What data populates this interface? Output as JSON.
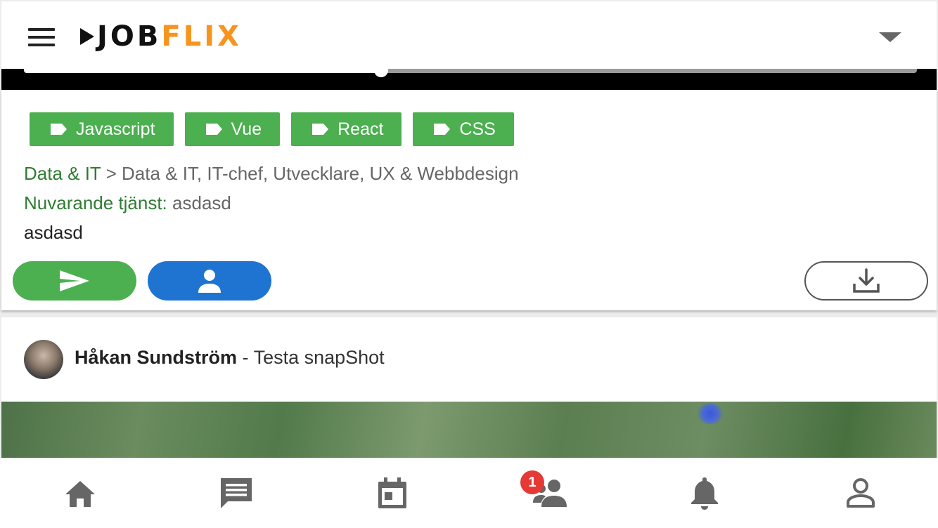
{
  "header": {
    "logo_part1": "JOBFLIX",
    "logo_dark": "JOB",
    "logo_accent": "FLIX",
    "accent_color": "#f7941d"
  },
  "video": {
    "progress": 0.4
  },
  "card": {
    "tags": [
      {
        "label": "Javascript"
      },
      {
        "label": "Vue"
      },
      {
        "label": "React"
      },
      {
        "label": "CSS"
      }
    ],
    "category_main": "Data & IT",
    "category_sub": " > Data & IT, IT-chef, Utvecklare, UX & Webbdesign",
    "current_label": "Nuvarande tjänst:",
    "current_value": " asdasd",
    "description": "asdasd",
    "tag_color": "#4caf50",
    "send_color": "#4caf50",
    "profile_color": "#1e74d0"
  },
  "post": {
    "author": "Håkan Sundström",
    "separator": " - ",
    "title": "Testa snapShot"
  },
  "bottom_nav": {
    "items": [
      "home-icon",
      "chat-icon",
      "calendar-icon",
      "people-icon",
      "bell-icon",
      "account-icon"
    ],
    "badge_count": "1"
  }
}
